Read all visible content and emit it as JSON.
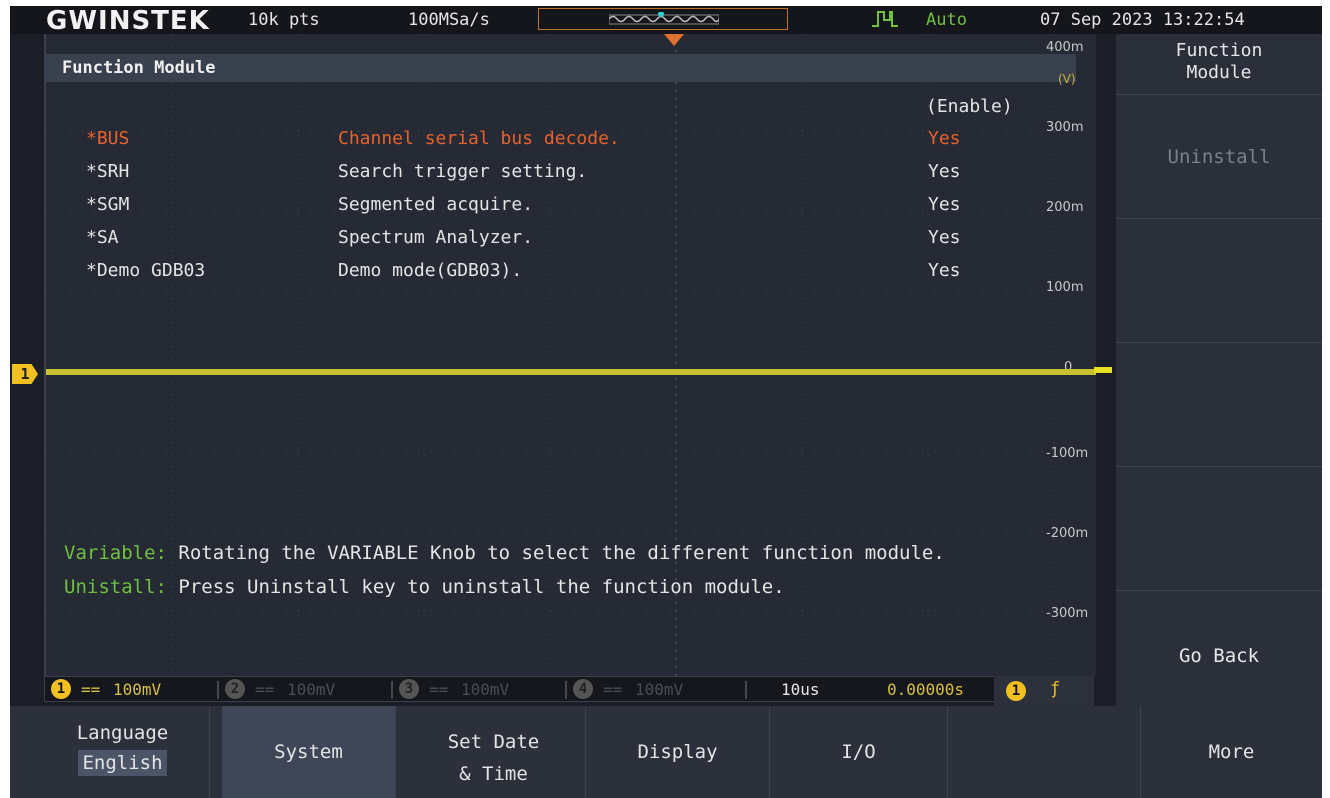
{
  "topbar": {
    "brand": "GWINSTEK",
    "record_length": "10k pts",
    "sample_rate": "100MSa/s",
    "trigger_mode": "Auto",
    "datetime": "07 Sep 2023 13:22:54"
  },
  "panel": {
    "title": "Function Module",
    "enable_header": "(Enable)",
    "modules": [
      {
        "name": "*BUS",
        "description": "Channel serial bus decode.",
        "enabled": "Yes",
        "selected": true
      },
      {
        "name": "*SRH",
        "description": "Search trigger setting.",
        "enabled": "Yes",
        "selected": false
      },
      {
        "name": "*SGM",
        "description": "Segmented acquire.",
        "enabled": "Yes",
        "selected": false
      },
      {
        "name": "*SA",
        "description": "Spectrum Analyzer.",
        "enabled": "Yes",
        "selected": false
      },
      {
        "name": "*Demo GDB03",
        "description": "Demo mode(GDB03).",
        "enabled": "Yes",
        "selected": false
      }
    ],
    "help": [
      {
        "key": "Variable:",
        "text": " Rotating the VARIABLE Knob to select the different function module."
      },
      {
        "key": "Unistall:",
        "text": " Press Uninstall key to uninstall the function module."
      }
    ]
  },
  "vertical_scale": {
    "unit": "(V)",
    "ticks": [
      "400m",
      "300m",
      "200m",
      "100m",
      "0",
      "-100m",
      "-200m",
      "-300m"
    ]
  },
  "channel_marker": "1",
  "channels": [
    {
      "num": "1",
      "coupling": "==",
      "scale": "100mV",
      "active": true
    },
    {
      "num": "2",
      "coupling": "==",
      "scale": "100mV",
      "active": false
    },
    {
      "num": "3",
      "coupling": "==",
      "scale": "100mV",
      "active": false
    },
    {
      "num": "4",
      "coupling": "==",
      "scale": "100mV",
      "active": false
    }
  ],
  "timebase": {
    "scale": "10us",
    "position": "0.00000s",
    "trigger_source": "1",
    "trigger_slope": "ƒ"
  },
  "side_menu": {
    "title_line1": "Function",
    "title_line2": "Module",
    "uninstall": "Uninstall",
    "go_back": "Go Back"
  },
  "bottom_menu": {
    "language": "Language",
    "language_value": "English",
    "system": "System",
    "set_date_line1": "Set Date",
    "set_date_line2": "& Time",
    "display": "Display",
    "io": "I/O",
    "more": "More"
  },
  "colors": {
    "accent_selected": "#e8622c",
    "channel1": "#f2c020",
    "help_key": "#70c040"
  }
}
